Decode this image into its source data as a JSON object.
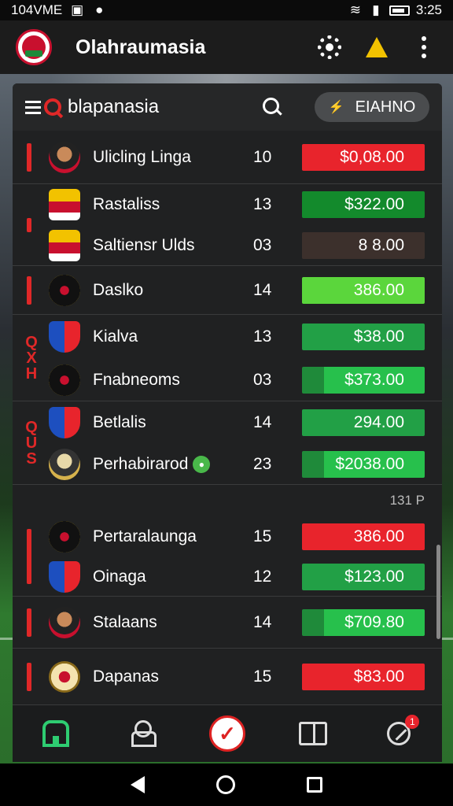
{
  "status_bar": {
    "carrier": "104VME",
    "time": "3:25"
  },
  "app": {
    "title": "Olahraumasia"
  },
  "panel": {
    "title": "blapanasia",
    "filter_label": "EIAHNO",
    "filter_icon": "⚡"
  },
  "list_groups": [
    {
      "rows": [
        {
          "team": "Ulicling Linga",
          "number": "10",
          "price": "$0,08.00",
          "style": "red",
          "crest": "crest-player-1"
        }
      ]
    },
    {
      "rows": [
        {
          "team": "Rastaliss",
          "number": "13",
          "price": "$322.00",
          "style": "dkgreen",
          "crest": "crest-red-yellow"
        },
        {
          "team": "Saltiensr Ulds",
          "number": "03",
          "price": "8 8.00",
          "style": "brown",
          "crest": "crest-red-yellow"
        }
      ]
    },
    {
      "rows": [
        {
          "team": "Daslko",
          "number": "14",
          "price": "386.00",
          "style": "lime",
          "crest": "crest-black-gold"
        }
      ]
    },
    {
      "side_letters": "Q X H",
      "rows": [
        {
          "team": "Kialva",
          "number": "13",
          "price": "$38.00",
          "style": "green",
          "crest": "crest-blue-red"
        },
        {
          "team": "Fnabneoms",
          "number": "03",
          "price": "$373.00",
          "style": "split",
          "crest": "crest-black-gold"
        }
      ]
    },
    {
      "side_letters": "Q U S",
      "rows": [
        {
          "team": "Betlalis",
          "number": "14",
          "price": "294.00",
          "style": "green",
          "crest": "crest-blue-red"
        },
        {
          "team": "Perhabirarod",
          "number": "23",
          "price": "$2038.00",
          "style": "split",
          "crest": "crest-player-2",
          "live": true
        }
      ]
    },
    {
      "updated": "131 P",
      "rows": [
        {
          "team": "Pertaralaunga",
          "number": "15",
          "price": "386.00",
          "style": "red",
          "crest": "crest-black-gold"
        },
        {
          "team": "Oinaga",
          "number": "12",
          "price": "$123.00",
          "style": "green",
          "crest": "crest-blue-red"
        }
      ]
    },
    {
      "rows": [
        {
          "team": "Stalaans",
          "number": "14",
          "price": "$709.80",
          "style": "split",
          "crest": "crest-player-1"
        }
      ]
    },
    {
      "rows": [
        {
          "team": "Dapanas",
          "number": "15",
          "price": "$83.00",
          "style": "red",
          "crest": "crest-gold-seal"
        }
      ]
    }
  ],
  "bottom_nav": [
    {
      "name": "home",
      "icon": "home-icon",
      "active": true
    },
    {
      "name": "players",
      "icon": "user-icon"
    },
    {
      "name": "picks",
      "icon": "check-icon"
    },
    {
      "name": "news",
      "icon": "book-icon"
    },
    {
      "name": "referee",
      "icon": "whistle-icon",
      "badge": "1"
    }
  ],
  "colors": {
    "red": "#e8242c",
    "green": "#22a046",
    "dkgreen": "#138a2c",
    "lime": "#5bd63c",
    "brown": "#3c302c",
    "accent": "#2ecc71"
  }
}
